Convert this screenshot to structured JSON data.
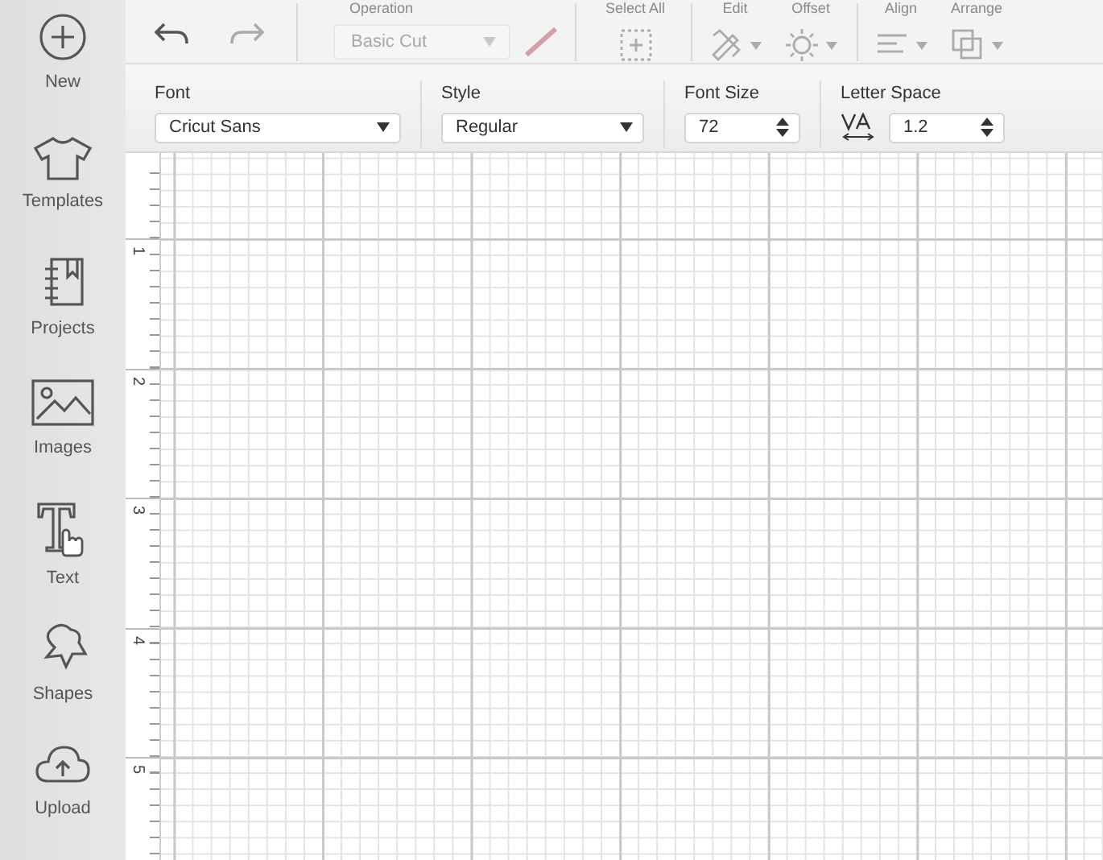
{
  "sidebar": {
    "items": [
      {
        "label": "New",
        "kind": "new"
      },
      {
        "label": "Templates",
        "kind": "templates"
      },
      {
        "label": "Projects",
        "kind": "projects"
      },
      {
        "label": "Images",
        "kind": "images"
      },
      {
        "label": "Text",
        "kind": "text"
      },
      {
        "label": "Shapes",
        "kind": "shapes"
      },
      {
        "label": "Upload",
        "kind": "upload"
      }
    ]
  },
  "toolbar": {
    "history": [
      {
        "kind": "undo",
        "disabled": false
      },
      {
        "kind": "redo",
        "disabled": true
      }
    ],
    "operation": {
      "label": "Operation",
      "value": "Basic Cut",
      "disabled": true
    },
    "tools": [
      {
        "label": "Select All",
        "kind": "select-all",
        "disabled": true
      },
      {
        "label": "Edit",
        "kind": "edit",
        "disabled": true
      },
      {
        "label": "Offset",
        "kind": "offset",
        "disabled": true
      },
      {
        "label": "Align",
        "kind": "align",
        "disabled": true
      },
      {
        "label": "Arrange",
        "kind": "arrange",
        "disabled": true
      }
    ]
  },
  "text_panel": {
    "font": {
      "label": "Font",
      "value": "Cricut Sans"
    },
    "style": {
      "label": "Style",
      "value": "Regular"
    },
    "font_size": {
      "label": "Font Size",
      "value": "72"
    },
    "letter_space": {
      "label": "Letter Space",
      "value": "1.2"
    }
  },
  "ruler": {
    "marks": [
      "1",
      "2",
      "3",
      "4",
      "5"
    ]
  }
}
